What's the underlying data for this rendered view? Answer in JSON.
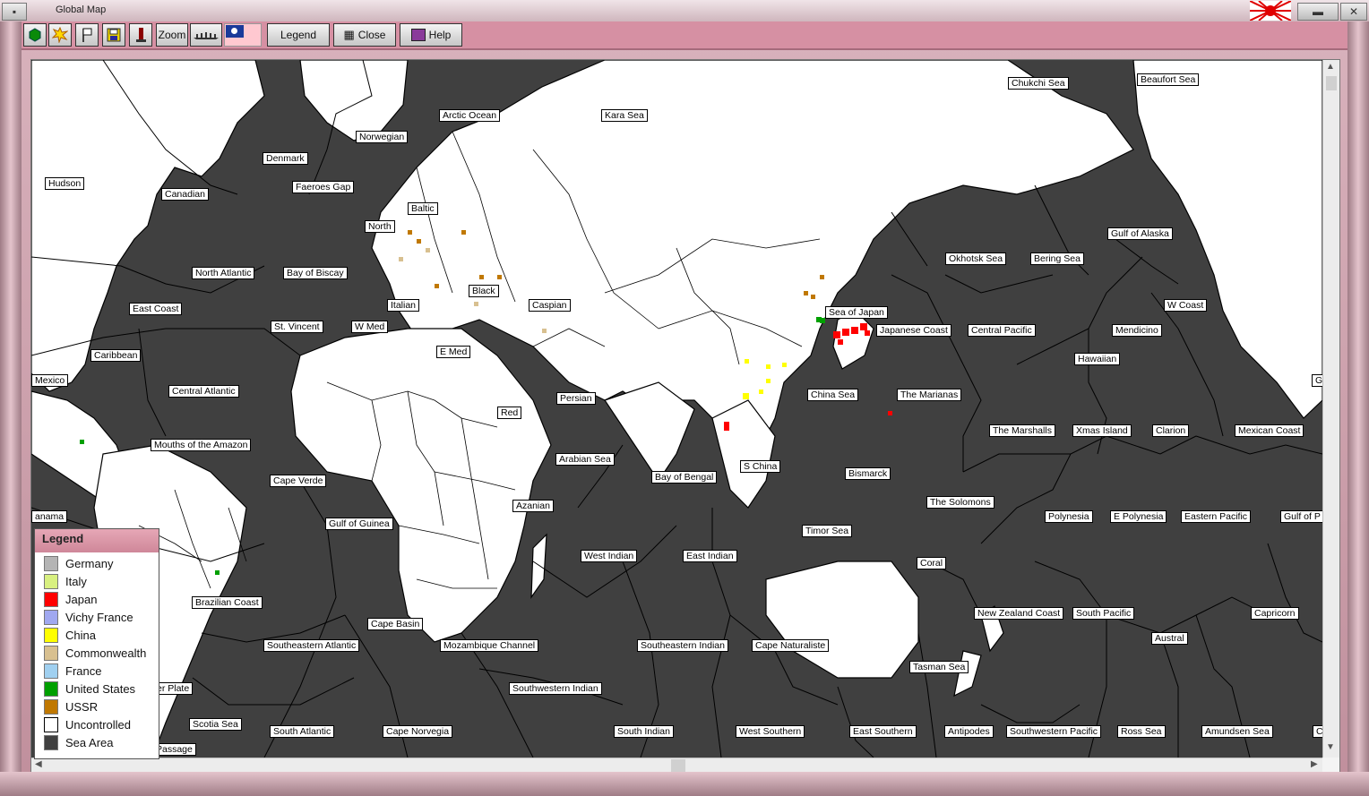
{
  "window": {
    "title": "Global Map"
  },
  "toolbar": {
    "zoom": "Zoom",
    "legend": "Legend",
    "close": "Close",
    "help": "Help"
  },
  "icons": [
    "hexagon-icon",
    "explosion-icon",
    "flag-icon",
    "save-icon",
    "tower-icon",
    "ships-icon",
    "china-flag-icon",
    "japan-flag-icon",
    "close-icon",
    "help-book-icon"
  ],
  "sea_areas": [
    "Chukchi Sea",
    "Beaufort Sea",
    "Arctic Ocean",
    "Kara Sea",
    "Norwegian",
    "Denmark",
    "Hudson",
    "Faeroes Gap",
    "Canadian",
    "Baltic",
    "North",
    "North Atlantic",
    "Bay of Biscay",
    "Gulf of Alaska",
    "Okhotsk Sea",
    "Bering Sea",
    "Black",
    "Caspian",
    "Italian",
    "East Coast",
    "Sea of Japan",
    "Japanese Coast",
    "Central Pacific",
    "W Coast",
    "St. Vincent",
    "W Med",
    "Mendicino",
    "E Med",
    "Caribbean",
    "Hawaiian",
    "Mexico",
    "Central Atlantic",
    "Persian",
    "China Sea",
    "The Marianas",
    "Red",
    "The Marshalls",
    "Xmas Island",
    "Clarion",
    "Mexican Coast",
    "Mouths of the Amazon",
    "Arabian Sea",
    "S China",
    "Bay of Bengal",
    "Bismarck",
    "Cape Verde",
    "The Solomons",
    "Azanian",
    "Polynesia",
    "E Polynesia",
    "Eastern Pacific",
    "Gulf of P",
    "anama",
    "Gulf of Guinea",
    "Timor Sea",
    "West Indian",
    "East Indian",
    "Coral",
    "Brazilian Coast",
    "New Zealand Coast",
    "South Pacific",
    "Capricorn",
    "Cape Basin",
    "Austral",
    "Southeastern Atlantic",
    "Mozambique Channel",
    "Southeastern Indian",
    "Cape Naturaliste",
    "Tasman Sea",
    "Southwestern Indian",
    "er Plate",
    "Scotia Sea",
    "South Atlantic",
    "Cape Norvegia",
    "South Indian",
    "West Southern",
    "East Southern",
    "Antipodes",
    "Southwestern Pacific",
    "Ross Sea",
    "Amundsen Sea",
    "Passage",
    "Ch",
    "G"
  ],
  "legend": {
    "title": "Legend",
    "items": [
      {
        "label": "Germany",
        "color": "#b4b4b4"
      },
      {
        "label": "Italy",
        "color": "#d8f080"
      },
      {
        "label": "Japan",
        "color": "#ff0000"
      },
      {
        "label": "Vichy France",
        "color": "#a0a8f0"
      },
      {
        "label": "China",
        "color": "#ffff00"
      },
      {
        "label": "Commonwealth",
        "color": "#d8c090"
      },
      {
        "label": "France",
        "color": "#a0d0f0"
      },
      {
        "label": "United States",
        "color": "#00a000"
      },
      {
        "label": "USSR",
        "color": "#c07800"
      },
      {
        "label": "Uncontrolled",
        "color": "#ffffff"
      },
      {
        "label": "Sea Area",
        "color": "#404040"
      }
    ]
  }
}
